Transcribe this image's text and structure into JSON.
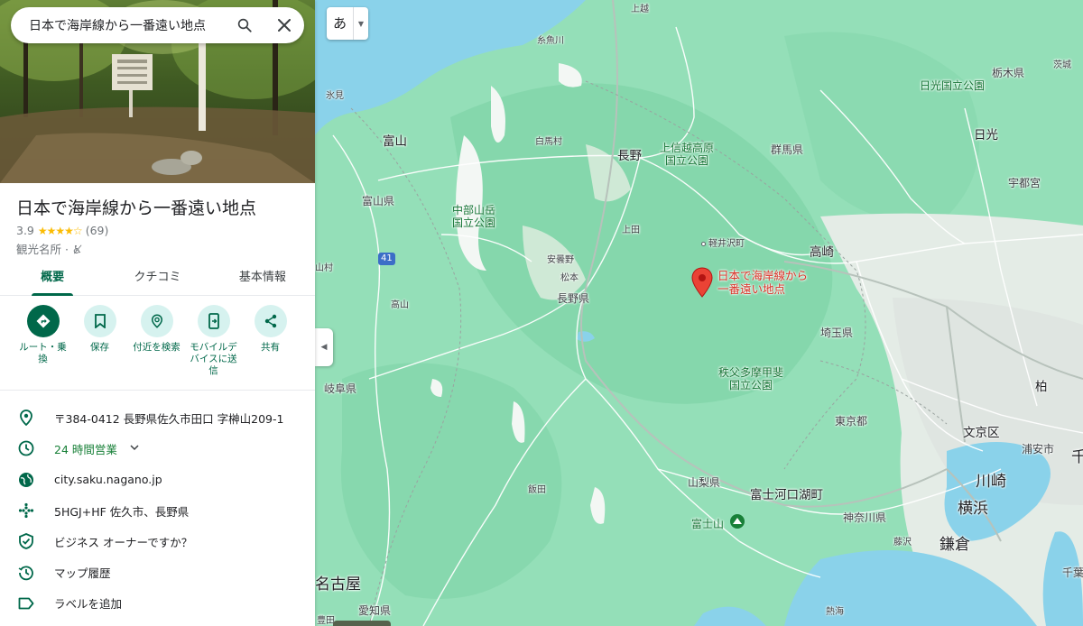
{
  "search": {
    "query": "日本で海岸線から一番遠い地点"
  },
  "place": {
    "title": "日本で海岸線から一番遠い地点",
    "rating": "3.9",
    "stars": "★★★★☆",
    "reviews": "(69)",
    "category": "観光名所 · ♿̸"
  },
  "tabs": [
    {
      "label": "概要",
      "active": true
    },
    {
      "label": "クチコミ",
      "active": false
    },
    {
      "label": "基本情報",
      "active": false
    }
  ],
  "actions": [
    {
      "label": "ルート・乗換",
      "icon": "directions-icon"
    },
    {
      "label": "保存",
      "icon": "bookmark-icon"
    },
    {
      "label": "付近を検索",
      "icon": "nearby-icon"
    },
    {
      "label": "モバイルデバイスに送信",
      "icon": "send-to-phone-icon"
    },
    {
      "label": "共有",
      "icon": "share-icon"
    }
  ],
  "info": {
    "address": "〒384-0412 長野県佐久市田口 字榊山209-1",
    "hours": "24 時間営業",
    "website": "city.saku.nagano.jp",
    "pluscode": "5HGJ+HF 佐久市、長野県",
    "owner": "ビジネス オーナーですか？",
    "history": "マップ履歴",
    "label": "ラベルを追加"
  },
  "map": {
    "lang_button": "あ",
    "pin_label_1": "日本で海岸線から",
    "pin_label_2": "一番遠い地点",
    "labels": {
      "joetsu": "上越",
      "itoigawa": "糸魚川",
      "himi": "氷見",
      "toyama": "富山",
      "toyama_pref": "富山県",
      "hakuba": "白馬村",
      "nagano": "長野",
      "joshinetsu_1": "上信越高原",
      "joshinetsu_2": "国立公園",
      "gunma": "群馬県",
      "tochigi": "栃木県",
      "nikko_park": "日光国立公園",
      "nikko": "日光",
      "utsunomiya": "宇都宮",
      "ibaraki": "茨城",
      "chubu_1": "中部山岳",
      "chubu_2": "国立公園",
      "ueda": "上田",
      "karuizawa": "軽井沢町",
      "takasaki": "高崎",
      "azumino": "安曇野",
      "matsumoto": "松本",
      "nagano_pref": "長野県",
      "route41": "41",
      "kamioka": "山村",
      "takayama": "高山",
      "saitama": "埼玉県",
      "chichibu_1": "秩父多摩甲斐",
      "chichibu_2": "国立公園",
      "gifu": "岐阜県",
      "tokyo": "東京都",
      "kashiwa": "柏",
      "bunkyo": "文京区",
      "urayasu": "浦安市",
      "chiba": "千",
      "yamanashi": "山梨県",
      "fujikawaguchiko": "富士河口湖町",
      "iida": "飯田",
      "fujisan": "富士山",
      "kanagawa": "神奈川県",
      "kawasaki": "川崎",
      "yokohama": "横浜",
      "fujisawa": "藤沢",
      "kamakura": "鎌倉",
      "chiba_pref": "千葉",
      "nagoya": "名古屋",
      "aichi": "愛知県",
      "toyota": "豊田",
      "atami": "熱海"
    }
  },
  "colors": {
    "accent": "#00684a",
    "accent_light": "#d6f2ef",
    "star": "#fbbc04",
    "pin": "#ea4335",
    "map_green": "#8fdcb4",
    "water": "#8ab4f8"
  }
}
